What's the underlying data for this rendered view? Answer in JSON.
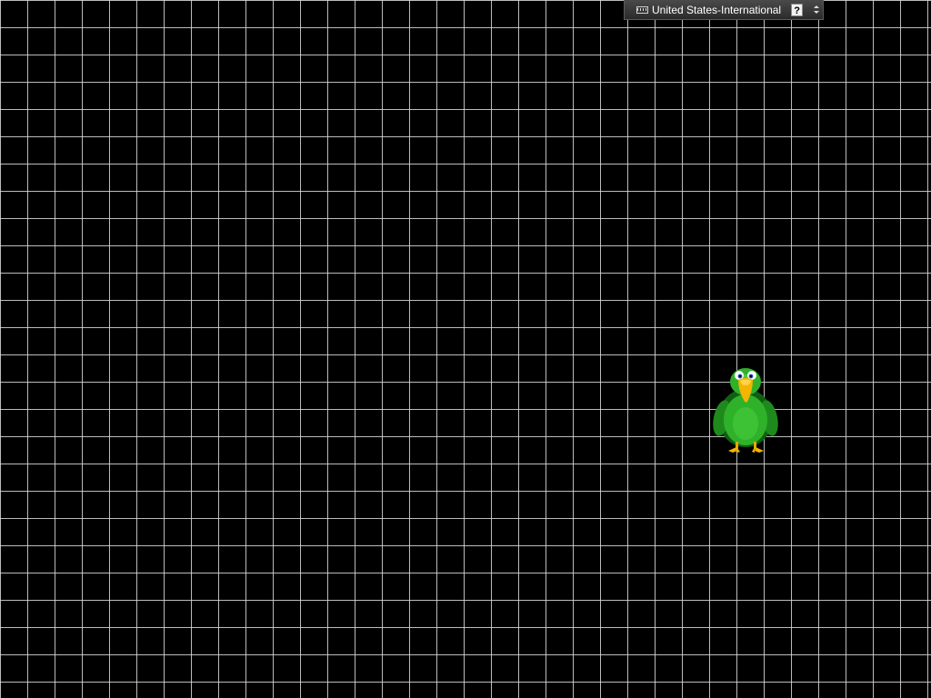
{
  "desktop": {
    "background_color": "#000000",
    "grid_color": "#dcdcdc"
  },
  "language_bar": {
    "keyboard_icon": "keyboard-icon",
    "language_label": "United States-International",
    "help_glyph": "?",
    "help_icon": "help-icon",
    "options_icon": "expand-arrows-icon"
  },
  "agent": {
    "character": "green-parrot-icon",
    "body_color": "#2fb12a",
    "beak_color": "#f4b400"
  }
}
